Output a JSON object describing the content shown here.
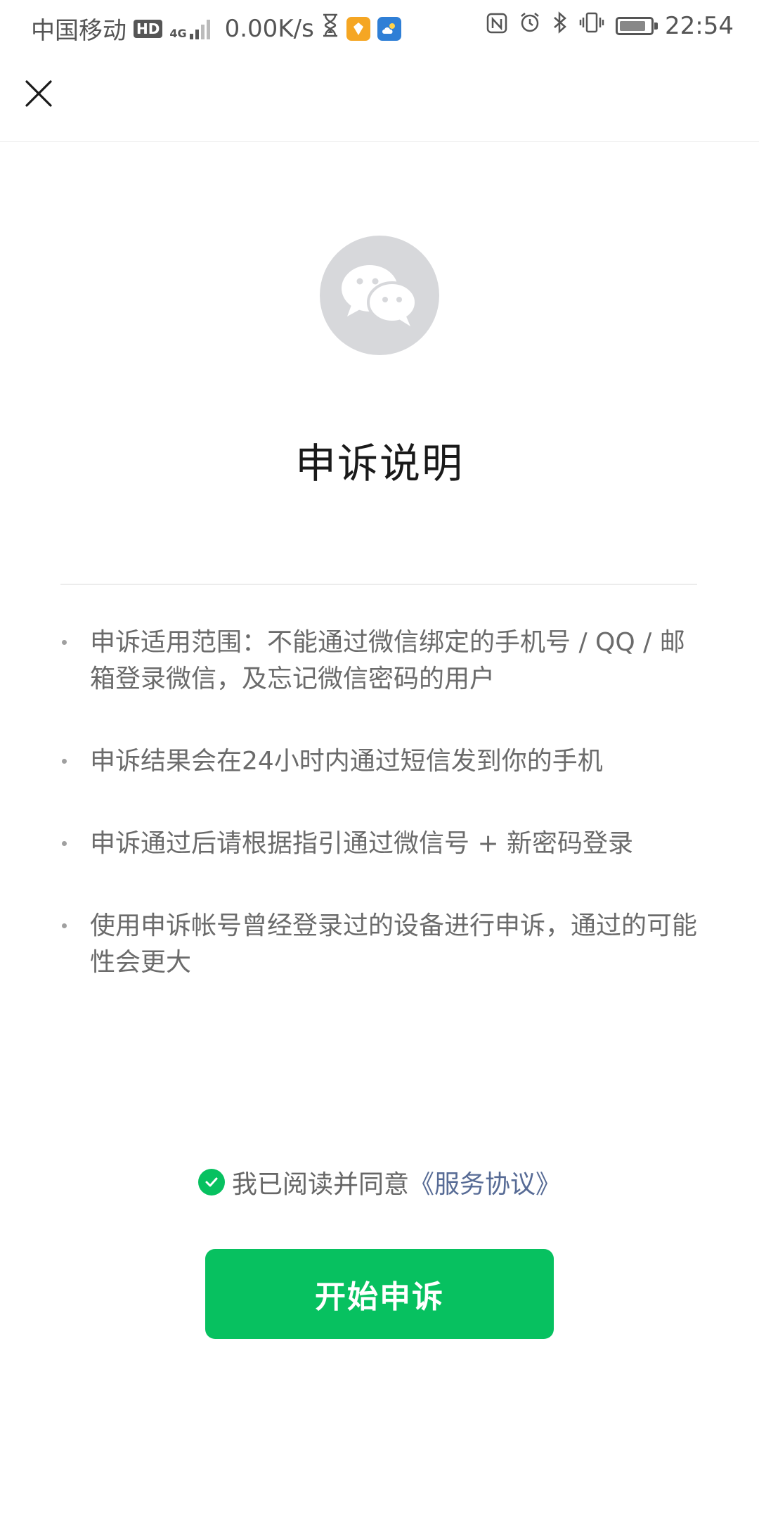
{
  "status_bar": {
    "carrier": "中国移动",
    "hd_badge": "HD",
    "network_type": "4G",
    "speed": "0.00K/s",
    "time": "22:54",
    "battery_level_percent": 85,
    "icons": [
      "hd-icon",
      "signal-icon",
      "hourglass-icon",
      "app-notification-icon",
      "weather-icon",
      "nfc-icon",
      "alarm-icon",
      "bluetooth-icon",
      "vibrate-icon",
      "battery-icon"
    ]
  },
  "nav": {
    "close_icon": "close-icon"
  },
  "header": {
    "avatar_icon": "wechat-logo-icon",
    "title": "申诉说明"
  },
  "notes": [
    {
      "text": "申诉适用范围：不能通过微信绑定的手机号 / QQ / 邮箱登录微信，及忘记微信密码的用户"
    },
    {
      "text": "申诉结果会在24小时内通过短信发到你的手机"
    },
    {
      "text": "申诉通过后请根据指引通过微信号 + 新密码登录"
    },
    {
      "text": "使用申诉帐号曾经登录过的设备进行申诉，通过的可能性会更大"
    }
  ],
  "agreement": {
    "checked": true,
    "prefix": "我已阅读并同意",
    "link": "《服务协议》"
  },
  "actions": {
    "start_label": "开始申诉"
  },
  "colors": {
    "primary": "#07c160",
    "link": "#576b95",
    "avatar_bg": "#d7d8db",
    "title": "#1a1a1a",
    "body_text": "#6b6b6b"
  }
}
